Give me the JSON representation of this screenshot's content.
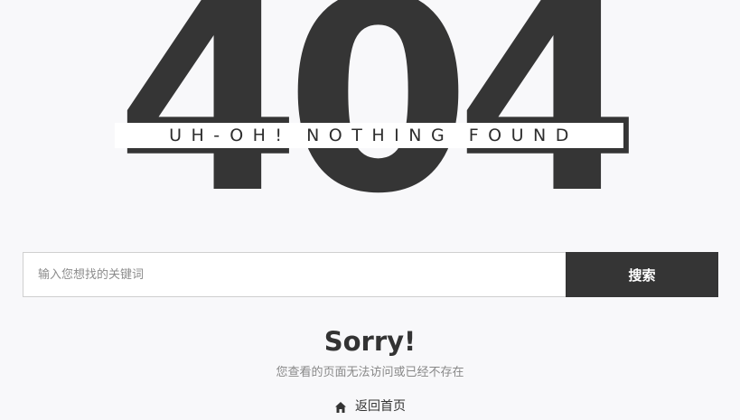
{
  "hero": {
    "code": "404",
    "banner": "UH-OH! NOTHING FOUND"
  },
  "search": {
    "placeholder": "输入您想找的关键词",
    "value": "",
    "button_label": "搜索"
  },
  "message": {
    "title": "Sorry!",
    "subtitle": "您查看的页面无法访问或已经不存在"
  },
  "home_link": {
    "icon": "home-icon",
    "label": "返回首页"
  },
  "colors": {
    "background": "#f8f8fa",
    "dark": "#353535",
    "muted": "#888888"
  }
}
